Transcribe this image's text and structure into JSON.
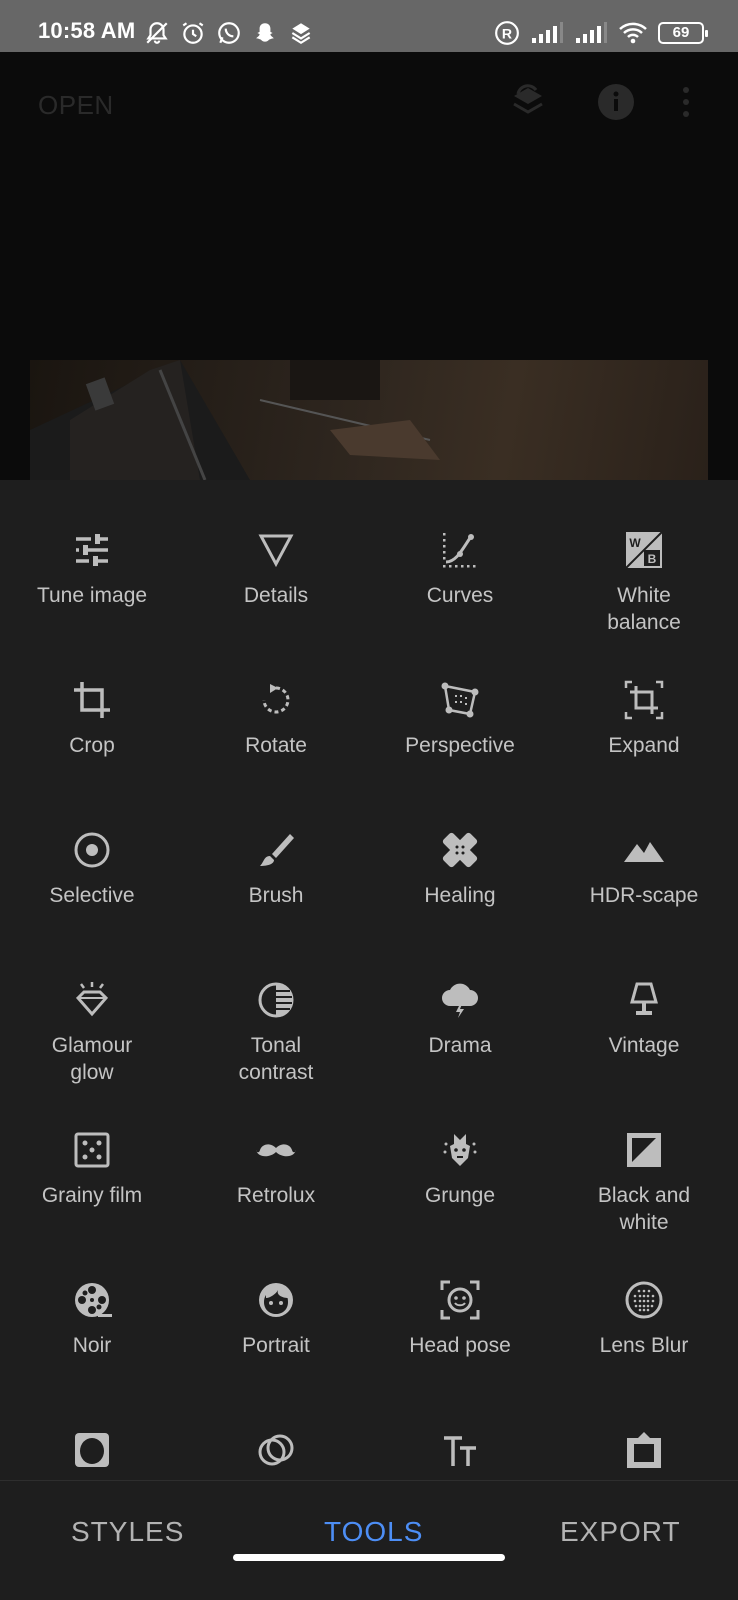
{
  "status_bar": {
    "time": "10:58 AM",
    "battery": "69",
    "registered_mark": "R"
  },
  "header": {
    "open_label": "OPEN"
  },
  "tools": [
    {
      "label": "Tune image",
      "icon": "tune-icon"
    },
    {
      "label": "Details",
      "icon": "details-triangle-icon"
    },
    {
      "label": "Curves",
      "icon": "curves-icon"
    },
    {
      "label": "White\nbalance",
      "icon": "white-balance-icon"
    },
    {
      "label": "Crop",
      "icon": "crop-icon"
    },
    {
      "label": "Rotate",
      "icon": "rotate-icon"
    },
    {
      "label": "Perspective",
      "icon": "perspective-icon"
    },
    {
      "label": "Expand",
      "icon": "expand-icon"
    },
    {
      "label": "Selective",
      "icon": "selective-icon"
    },
    {
      "label": "Brush",
      "icon": "brush-icon"
    },
    {
      "label": "Healing",
      "icon": "healing-icon"
    },
    {
      "label": "HDR-scape",
      "icon": "hdr-mountain-icon"
    },
    {
      "label": "Glamour\nglow",
      "icon": "glamour-glow-icon"
    },
    {
      "label": "Tonal\ncontrast",
      "icon": "tonal-contrast-icon"
    },
    {
      "label": "Drama",
      "icon": "drama-cloud-icon"
    },
    {
      "label": "Vintage",
      "icon": "vintage-lamp-icon"
    },
    {
      "label": "Grainy film",
      "icon": "grainy-film-icon"
    },
    {
      "label": "Retrolux",
      "icon": "retrolux-mustache-icon"
    },
    {
      "label": "Grunge",
      "icon": "grunge-icon"
    },
    {
      "label": "Black and\nwhite",
      "icon": "black-and-white-icon"
    },
    {
      "label": "Noir",
      "icon": "noir-film-reel-icon"
    },
    {
      "label": "Portrait",
      "icon": "portrait-face-icon"
    },
    {
      "label": "Head pose",
      "icon": "head-pose-icon"
    },
    {
      "label": "Lens Blur",
      "icon": "lens-blur-icon"
    }
  ],
  "bottom_nav": {
    "styles": "STYLES",
    "tools": "TOOLS",
    "export": "EXPORT",
    "active": "tools"
  },
  "colors": {
    "accent": "#4d8ef5",
    "sheet_bg": "#1e1e1e",
    "icon": "#bdbdbd"
  }
}
